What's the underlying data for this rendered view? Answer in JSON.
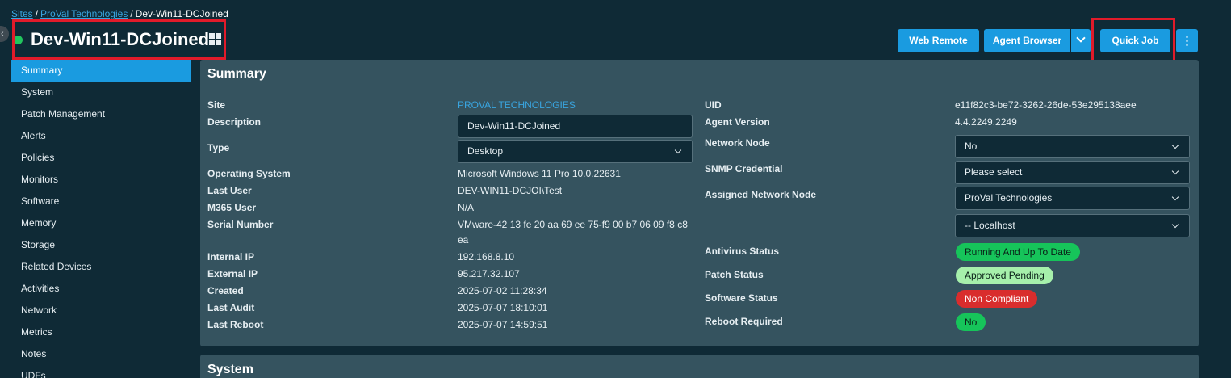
{
  "breadcrumb": {
    "sites": "Sites",
    "sep1": "/",
    "company": "ProVal Technologies",
    "sep2": "/",
    "current": "Dev-Win11-DCJoined"
  },
  "header": {
    "title": "Dev-Win11-DCJoined",
    "status": "online",
    "os_icon": "windows-icon"
  },
  "toolbar": {
    "web_remote": "Web Remote",
    "agent_browser": "Agent Browser",
    "quick_job": "Quick Job"
  },
  "sidebar": {
    "items": [
      {
        "label": "Summary",
        "active": true
      },
      {
        "label": "System"
      },
      {
        "label": "Patch Management"
      },
      {
        "label": "Alerts"
      },
      {
        "label": "Policies"
      },
      {
        "label": "Monitors"
      },
      {
        "label": "Software"
      },
      {
        "label": "Memory"
      },
      {
        "label": "Storage"
      },
      {
        "label": "Related Devices"
      },
      {
        "label": "Activities"
      },
      {
        "label": "Network"
      },
      {
        "label": "Metrics"
      },
      {
        "label": "Notes"
      },
      {
        "label": "UDFs"
      }
    ]
  },
  "summary": {
    "title": "Summary",
    "left": {
      "site_label": "Site",
      "site_value": "PROVAL TECHNOLOGIES",
      "description_label": "Description",
      "description_value": "Dev-Win11-DCJoined",
      "type_label": "Type",
      "type_value": "Desktop",
      "os_label": "Operating System",
      "os_value": "Microsoft Windows 11 Pro 10.0.22631",
      "last_user_label": "Last User",
      "last_user_value": "DEV-WIN11-DCJOI\\Test",
      "m365_label": "M365 User",
      "m365_value": "N/A",
      "serial_label": "Serial Number",
      "serial_value_line1": "VMware-42 13 fe 20 aa 69 ee 75-f9 00 b7 06 09 f8 c8",
      "serial_value_line2": "ea",
      "internal_ip_label": "Internal IP",
      "internal_ip_value": "192.168.8.10",
      "external_ip_label": "External IP",
      "external_ip_value": "95.217.32.107",
      "created_label": "Created",
      "created_value": "2025-07-02 11:28:34",
      "last_audit_label": "Last Audit",
      "last_audit_value": "2025-07-07 18:10:01",
      "last_reboot_label": "Last Reboot",
      "last_reboot_value": "2025-07-07 14:59:51"
    },
    "right": {
      "uid_label": "UID",
      "uid_value": "e11f82c3-be72-3262-26de-53e295138aee",
      "agent_version_label": "Agent Version",
      "agent_version_value": "4.4.2249.2249",
      "network_node_label": "Network Node",
      "network_node_value": "No",
      "snmp_label": "SNMP Credential",
      "snmp_placeholder": "Please select",
      "assigned_node_label": "Assigned Network Node",
      "assigned_node_value": "ProVal Technologies",
      "assigned_node_sub_value": "-- Localhost",
      "antivirus_label": "Antivirus Status",
      "antivirus_value": "Running And Up To Date",
      "patch_label": "Patch Status",
      "patch_value": "Approved Pending",
      "software_label": "Software Status",
      "software_value": "Non Compliant",
      "reboot_label": "Reboot Required",
      "reboot_value": "No"
    }
  },
  "system": {
    "title": "System"
  },
  "colors": {
    "accent": "#1a9be0",
    "background": "#0f2a36",
    "panel": "#35535f",
    "highlight_box": "#e11b2a",
    "status_online": "#22c55e",
    "pill_green": "#16c45a",
    "pill_light_green": "#a6f0ab",
    "pill_red": "#d92d2d"
  }
}
